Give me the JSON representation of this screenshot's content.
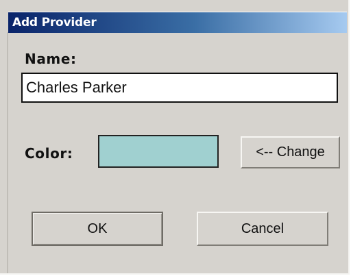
{
  "window": {
    "title": "Add Provider"
  },
  "form": {
    "name_label": "Name:",
    "name_value": "Charles Parker",
    "color_label": "Color:",
    "color_value": "#a0d0d0",
    "change_label": "<-- Change"
  },
  "buttons": {
    "ok_label": "OK",
    "cancel_label": "Cancel"
  }
}
